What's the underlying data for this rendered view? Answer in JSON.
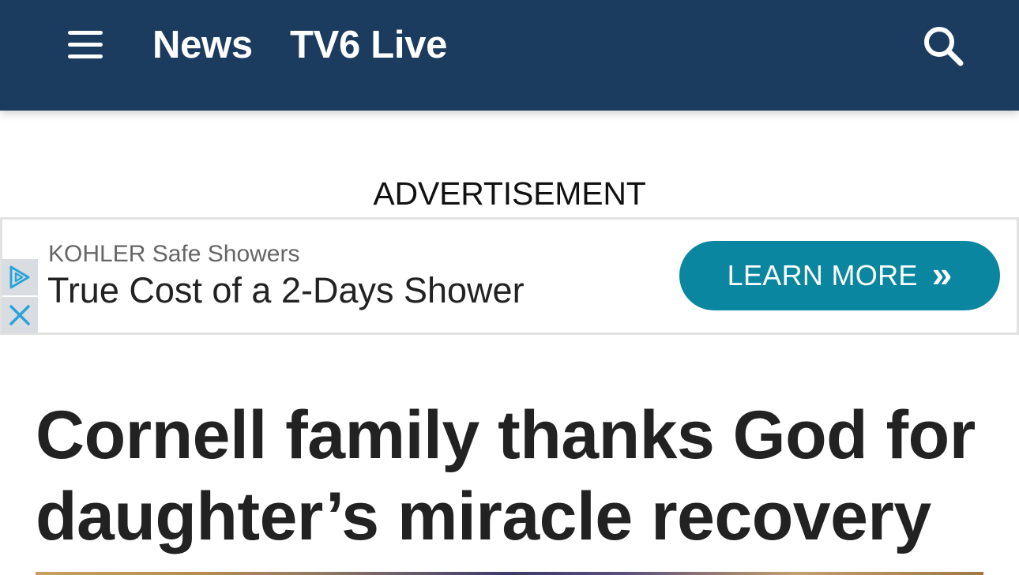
{
  "header": {
    "nav": {
      "news_label": "News",
      "live_label": "TV6 Live"
    },
    "icons": {
      "menu": "hamburger-menu-icon",
      "search": "search-icon"
    },
    "background_color": "#1c3c5f"
  },
  "ad": {
    "label": "ADVERTISEMENT",
    "sponsor": "KOHLER Safe Showers",
    "headline": "True Cost of a 2-Days Shower",
    "cta_label": "LEARN MORE",
    "cta_arrow": "»",
    "cta_color": "#0a86a1",
    "icons": {
      "adchoices": "adchoices-icon",
      "close": "close-icon"
    }
  },
  "article": {
    "headline": "Cornell family thanks God for daughter’s miracle recovery"
  }
}
